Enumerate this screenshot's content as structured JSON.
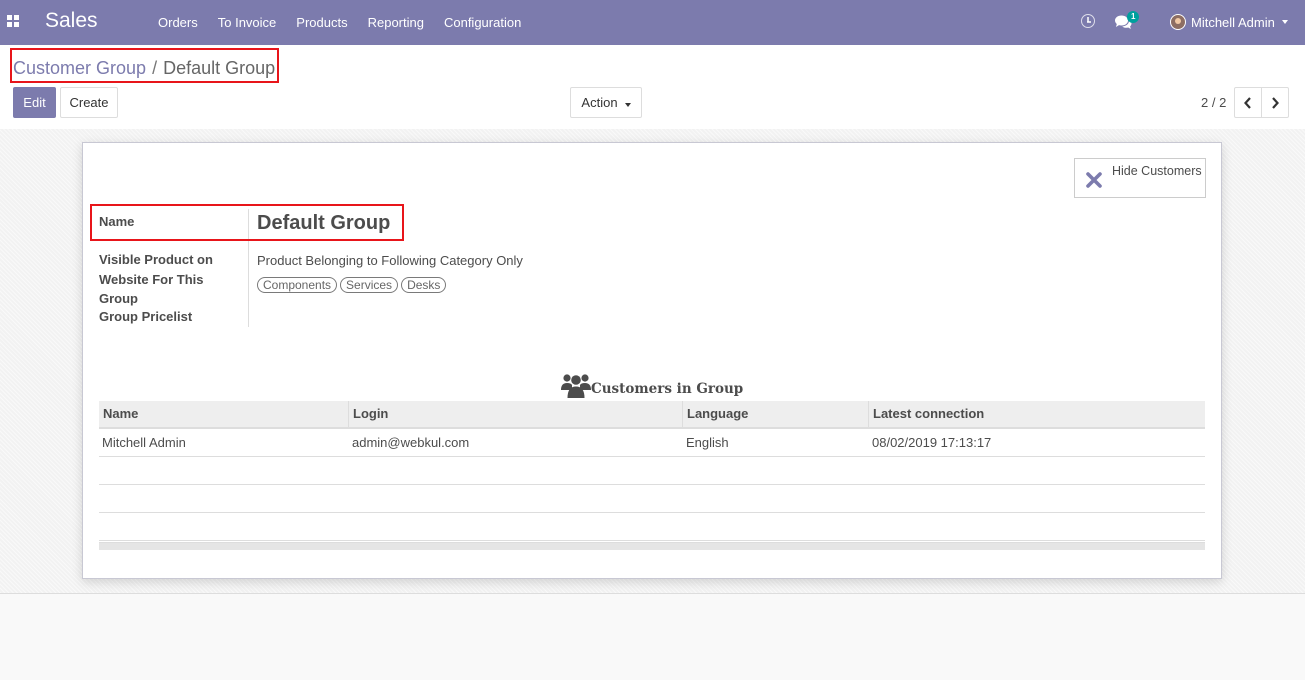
{
  "navbar": {
    "brand": "Sales",
    "menu": [
      "Orders",
      "To Invoice",
      "Products",
      "Reporting",
      "Configuration"
    ],
    "message_count": "1",
    "user": "Mitchell Admin",
    "color": "#7c7bad"
  },
  "breadcrumb": {
    "parent": "Customer Group",
    "separator": "/",
    "current": "Default Group"
  },
  "buttons": {
    "edit": "Edit",
    "create": "Create",
    "action": "Action"
  },
  "pager": {
    "value": "2 / 2"
  },
  "stat_button": {
    "label": "Hide Customers",
    "icon": "close-icon"
  },
  "form": {
    "name_label": "Name",
    "name_value": "Default Group",
    "visible_label": "Visible Product on Website For This Group",
    "visible_value": "Product Belonging to Following Category Only",
    "categories": [
      "Components",
      "Services",
      "Desks"
    ],
    "pricelist_label": "Group Pricelist",
    "pricelist_value": ""
  },
  "customers": {
    "title": "Customers in Group",
    "icon": "users-icon",
    "columns": [
      "Name",
      "Login",
      "Language",
      "Latest connection"
    ],
    "rows": [
      {
        "name": "Mitchell Admin",
        "login": "admin@webkul.com",
        "language": "English",
        "latest_connection": "08/02/2019 17:13:17"
      }
    ]
  }
}
